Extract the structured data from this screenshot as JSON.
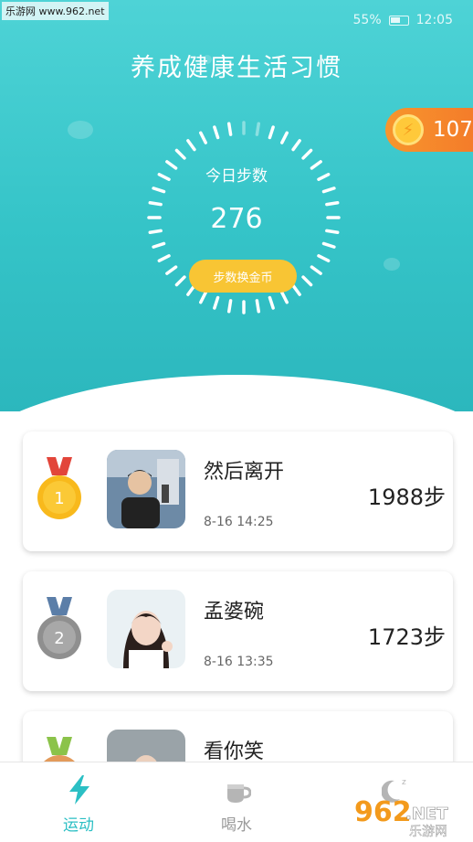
{
  "watermark_top": "乐游网 www.962.net",
  "status": {
    "battery": "55%",
    "time": "12:05"
  },
  "app_title": "养成健康生活习惯",
  "coins": "107",
  "today": {
    "label": "今日步数",
    "steps": "276",
    "exchange_button": "步数换金币"
  },
  "ranking": [
    {
      "rank": "1",
      "medal": "gold-medal-icon",
      "name": "然后离开",
      "time": "8-16 14:25",
      "steps": "1988步"
    },
    {
      "rank": "2",
      "medal": "silver-medal-icon",
      "name": "孟婆碗",
      "time": "8-16 13:35",
      "steps": "1723步"
    },
    {
      "rank": "3",
      "medal": "bronze-medal-icon",
      "name": "看你笑",
      "time": "",
      "steps": ""
    }
  ],
  "tabs": [
    {
      "label": "运动",
      "icon": "lightning-icon",
      "active": true
    },
    {
      "label": "喝水",
      "icon": "cup-icon",
      "active": false
    },
    {
      "label": "睡眠",
      "icon": "moon-icon",
      "active": false
    }
  ],
  "watermark_bottom": {
    "brand": "962",
    "suffix": ".NET",
    "sub": "乐游网"
  },
  "colors": {
    "primary": "#35c4c8",
    "accent_orange": "#f47c2a",
    "gold": "#f8c534",
    "tab_active": "#2bbfc4",
    "tab_inactive": "#9a9a9a"
  }
}
